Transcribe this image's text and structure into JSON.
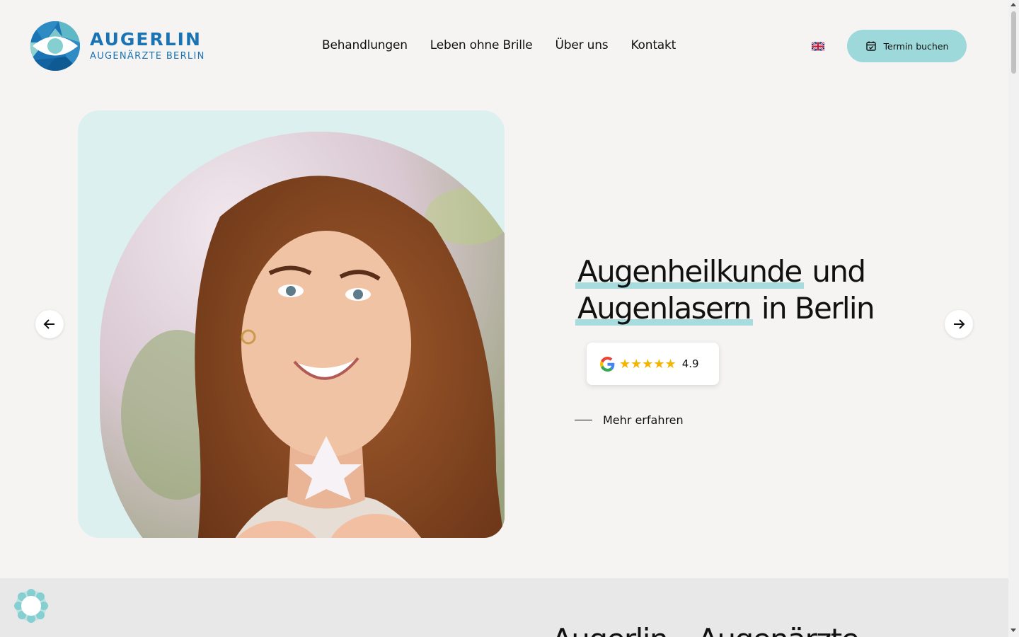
{
  "brand": {
    "name": "AUGERLIN",
    "tagline": "AUGENÄRZTE BERLIN",
    "color": "#1a73b5"
  },
  "nav": {
    "items": [
      {
        "label": "Behandlungen"
      },
      {
        "label": "Leben ohne Brille"
      },
      {
        "label": "Über uns"
      },
      {
        "label": "Kontakt"
      }
    ]
  },
  "header": {
    "language_icon": "uk-flag-icon",
    "cta_label": "Termin buchen",
    "cta_icon": "calendar-check-icon",
    "cta_color": "#9dd8da"
  },
  "hero": {
    "title_part1": "Augenheilkunde",
    "title_part2": " und ",
    "title_part3": "Augenlasern",
    "title_part4": " in Berlin",
    "rating_stars": "★★★★★",
    "rating_value": "4.9",
    "rating_source_icon": "google-g-icon",
    "more_label": "Mehr erfahren",
    "accent_color": "#a6dcdd",
    "card_color": "#dcf0ef"
  },
  "carousel": {
    "prev_icon": "arrow-left-icon",
    "next_icon": "arrow-right-icon"
  },
  "lower": {
    "title": "Augerlin – Augenärzte"
  },
  "widget": {
    "icon": "accessibility-widget-icon"
  }
}
